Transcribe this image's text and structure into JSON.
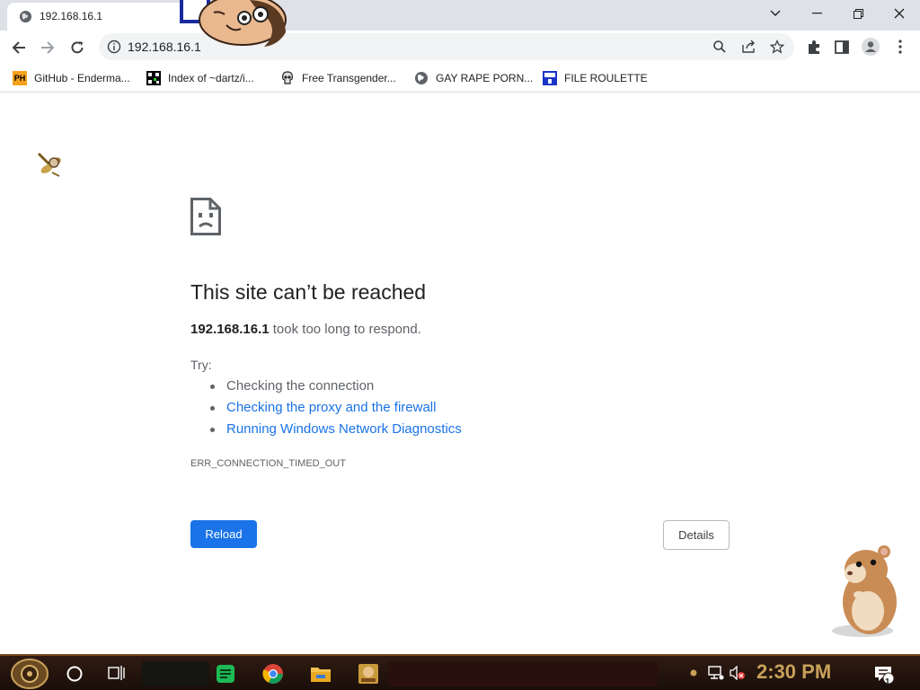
{
  "browser": {
    "tab": {
      "title": "192.168.16.1"
    },
    "address_bar": {
      "url": "192.168.16.1"
    }
  },
  "bookmarks": [
    {
      "label": "GitHub - Enderma...",
      "icon": "ph-badge-icon"
    },
    {
      "label": "Index of ~dartz/i...",
      "icon": "qr-icon"
    },
    {
      "label": "Free Transgender...",
      "icon": "skull-icon"
    },
    {
      "label": "GAY RAPE PORN...",
      "icon": "globe-icon"
    },
    {
      "label": "FILE ROULETTE",
      "icon": "mf-badge-icon"
    }
  ],
  "error_page": {
    "title": "This site can’t be reached",
    "host": "192.168.16.1",
    "description": " took too long to respond.",
    "try_label": "Try:",
    "suggestions": [
      {
        "text": "Checking the connection",
        "link": false
      },
      {
        "text": "Checking the proxy and the firewall",
        "link": true
      },
      {
        "text": "Running Windows Network Diagnostics",
        "link": true
      }
    ],
    "error_code": "ERR_CONNECTION_TIMED_OUT",
    "reload_label": "Reload",
    "details_label": "Details"
  },
  "taskbar": {
    "clock": "2:30 PM",
    "notification_count": "1"
  },
  "colors": {
    "accent": "#1a73e8",
    "link": "#1a73e8",
    "taskbar": "#2a160e",
    "clock": "#c8a15a"
  }
}
